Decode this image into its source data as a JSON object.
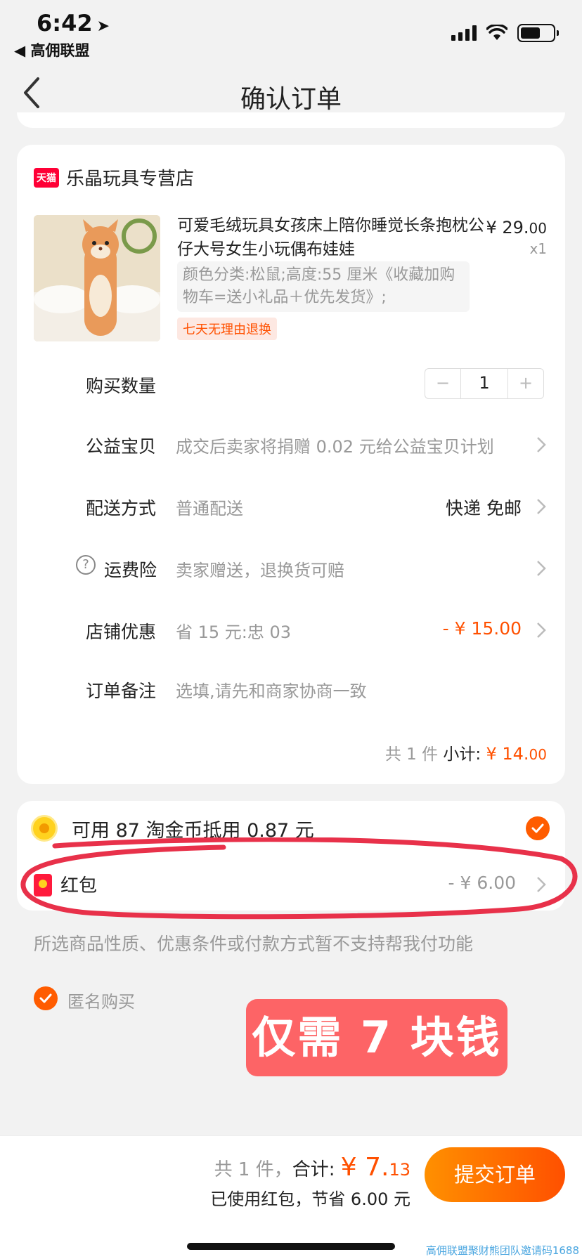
{
  "status_bar": {
    "time": "6:42",
    "back_app": "◀ 高佣联盟"
  },
  "nav": {
    "title": "确认订单"
  },
  "store": {
    "badge": "天猫",
    "name": "乐晶玩具专营店"
  },
  "product": {
    "title": "可爱毛绒玩具女孩床上陪你睡觉长条抱枕公仔大号女生小玩偶布娃娃",
    "price_main": "¥ 29.",
    "price_cents": "00",
    "qty": "x1",
    "sku": "颜色分类:松鼠;高度:55 厘米《收藏加购物车=送小礼品＋优先发货》;",
    "return_tag": "七天无理由退换"
  },
  "quantity": {
    "label": "购买数量",
    "minus": "−",
    "value": "1",
    "plus": "+"
  },
  "charity": {
    "label": "公益宝贝",
    "value": "成交后卖家将捐赠 0.02 元给公益宝贝计划"
  },
  "delivery": {
    "label": "配送方式",
    "value": "普通配送",
    "right": "快递 免邮"
  },
  "insurance": {
    "icon": "?",
    "label": "运费险",
    "value": "卖家赠送，退换货可赔"
  },
  "store_discount": {
    "label": "店铺优惠",
    "value": "省 15 元:忠 03",
    "right": "- ¥ 15.00"
  },
  "remark": {
    "label": "订单备注",
    "placeholder": "选填,请先和商家协商一致"
  },
  "subtotal": {
    "count": "共 1 件",
    "label": "小计:",
    "amount_main": "¥ 14.",
    "amount_cents": "00"
  },
  "coins": {
    "text": "可用 87 淘金币抵用 0.87 元"
  },
  "red_packet": {
    "label": "红包",
    "amount": "- ¥ 6.00"
  },
  "notice": "所选商品性质、优惠条件或付款方式暂不支持帮我付功能",
  "anonymous": {
    "label": "匿名购买"
  },
  "promo_label": "仅需 7 块钱",
  "bottom": {
    "count": "共 1 件，",
    "total_label": "合计:",
    "total_main": "¥ 7.",
    "total_cents": "13",
    "saved": "已使用红包，节省 6.00 元",
    "submit": "提交订单"
  },
  "watermark": "高佣联盟聚财熊团队邀请码1688",
  "colors": {
    "accent": "#ff5000",
    "tmall": "#ff0036",
    "promo": "#fd6466",
    "annotation_circle": "#e8314a"
  }
}
